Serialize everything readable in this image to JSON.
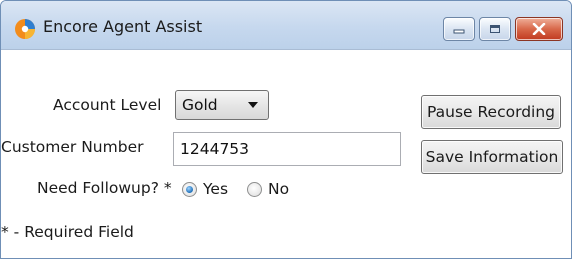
{
  "window": {
    "title": "Encore Agent Assist",
    "controls": {
      "minimize_icon": "minimize-icon",
      "maximize_icon": "maximize-icon",
      "close_icon": "close-icon",
      "close_color": "#c0391f"
    }
  },
  "form": {
    "account_level": {
      "label": "Account Level",
      "value": "Gold"
    },
    "customer_number": {
      "label": "Customer Number",
      "value": "1244753"
    },
    "need_followup": {
      "label": "Need Followup? *",
      "options": [
        {
          "label": "Yes",
          "checked": true
        },
        {
          "label": "No",
          "checked": false
        }
      ]
    },
    "required_note": "* - Required Field"
  },
  "actions": {
    "pause_recording": "Pause Recording",
    "save_information": "Save Information"
  }
}
